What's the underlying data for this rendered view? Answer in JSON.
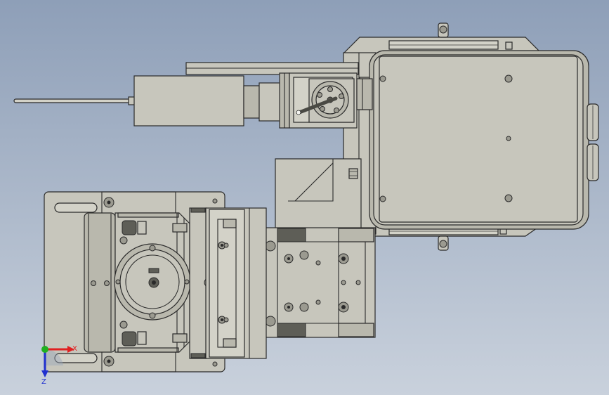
{
  "view": {
    "background_top": "#8e9fb8",
    "background_bottom": "#c9d1dc",
    "part_color": "#c7c6bc",
    "edge_color": "#2a2a2a"
  },
  "triad": {
    "x_label": "X",
    "z_label": "Z",
    "x_color": "#e02020",
    "y_color": "#20b020",
    "z_color": "#2030d0"
  }
}
